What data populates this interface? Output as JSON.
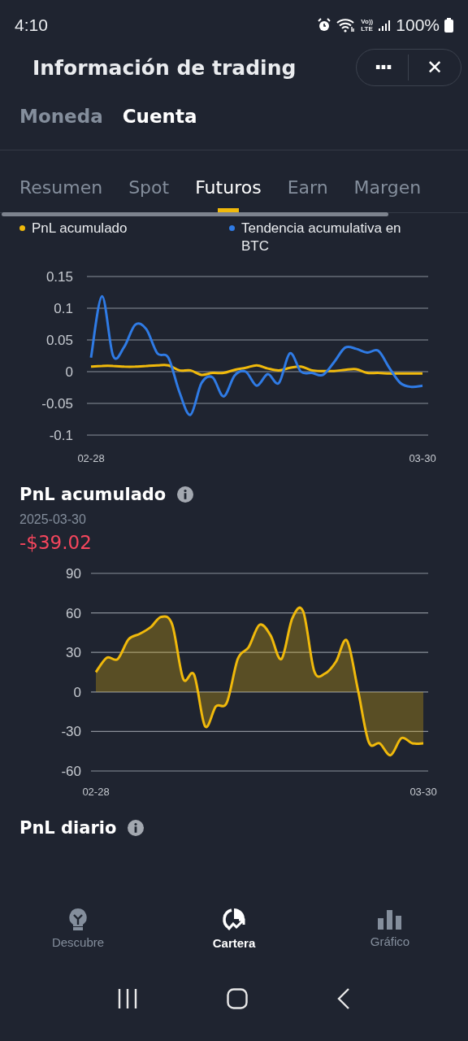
{
  "status_bar": {
    "time": "4:10",
    "network_top": "Vo))",
    "network_bottom": "LTE",
    "battery": "100%"
  },
  "header": {
    "title": "Información de trading",
    "more": "···",
    "close": "✕"
  },
  "sub_tabs": [
    {
      "label": "Moneda",
      "selected": false
    },
    {
      "label": "Cuenta",
      "selected": true
    }
  ],
  "tabs": [
    {
      "label": "Resumen",
      "selected": false
    },
    {
      "label": "Spot",
      "selected": false
    },
    {
      "label": "Futuros",
      "selected": true
    },
    {
      "label": "Earn",
      "selected": false
    },
    {
      "label": "Margen",
      "selected": false
    }
  ],
  "trend_chart": {
    "chart_data": {
      "type": "line",
      "grid": true,
      "legend": true,
      "categories": [
        "02-28",
        null,
        null,
        null,
        null,
        null,
        null,
        null,
        null,
        null,
        null,
        null,
        null,
        null,
        null,
        null,
        null,
        null,
        null,
        null,
        null,
        null,
        null,
        null,
        null,
        null,
        null,
        null,
        null,
        null,
        "03-30"
      ],
      "ylim": [
        -0.1,
        0.15
      ],
      "yticks": [
        {
          "value": 0.15,
          "label": "0.15"
        },
        {
          "value": 0.1,
          "label": "0.1"
        },
        {
          "value": 0.05,
          "label": "0.05"
        },
        {
          "value": 0,
          "label": "0"
        },
        {
          "value": -0.05,
          "label": "-0.05"
        },
        {
          "value": -0.1,
          "label": "-0.1"
        }
      ],
      "series": [
        {
          "name": "PnL acumulado",
          "color": "#f0b90b",
          "values": [
            0.008,
            0.009,
            0.009,
            0.008,
            0.008,
            0.009,
            0.01,
            0.01,
            0.002,
            0.002,
            -0.005,
            -0.002,
            -0.002,
            0.003,
            0.006,
            0.01,
            0.005,
            0.002,
            0.006,
            0.008,
            0.002,
            0.001,
            0.001,
            0.003,
            0.004,
            -0.002,
            -0.002,
            -0.003,
            -0.003,
            -0.003,
            -0.003
          ]
        },
        {
          "name": "Tendencia acumulativa en BTC",
          "color": "#2f7be5",
          "values": [
            0.022,
            0.119,
            0.025,
            0.039,
            0.074,
            0.067,
            0.029,
            0.022,
            -0.032,
            -0.068,
            -0.018,
            -0.009,
            -0.039,
            -0.006,
            0,
            -0.022,
            -0.004,
            -0.018,
            0.029,
            0,
            -0.002,
            -0.005,
            0.015,
            0.038,
            0.036,
            0.03,
            0.033,
            0.006,
            -0.018,
            -0.024,
            -0.022
          ]
        }
      ]
    }
  },
  "pnl_cumulative": {
    "title": "PnL acumulado",
    "date": "2025-03-30",
    "value": "-$39.02",
    "chart_data": {
      "type": "area",
      "grid": true,
      "categories": [
        "02-28",
        null,
        null,
        null,
        null,
        null,
        null,
        null,
        null,
        null,
        null,
        null,
        null,
        null,
        null,
        null,
        null,
        null,
        null,
        null,
        null,
        null,
        null,
        null,
        null,
        null,
        null,
        null,
        null,
        null,
        "03-30"
      ],
      "ylim": [
        -60,
        90
      ],
      "yticks": [
        90,
        60,
        30,
        0,
        -30,
        -60
      ],
      "series": [
        {
          "color": "#f0b90b",
          "values": [
            15,
            26,
            25,
            40,
            44,
            49,
            57,
            51,
            10,
            13,
            -26,
            -11,
            -8,
            25,
            34,
            51,
            43,
            25,
            56,
            61,
            16,
            14,
            23,
            39,
            2,
            -38,
            -39,
            -48,
            -35,
            -39,
            -39
          ]
        }
      ]
    }
  },
  "pnl_daily": {
    "title": "PnL diario"
  },
  "bottom_nav": [
    {
      "label": "Descubre",
      "selected": false
    },
    {
      "label": "Cartera",
      "selected": true
    },
    {
      "label": "Gráfico",
      "selected": false
    }
  ]
}
